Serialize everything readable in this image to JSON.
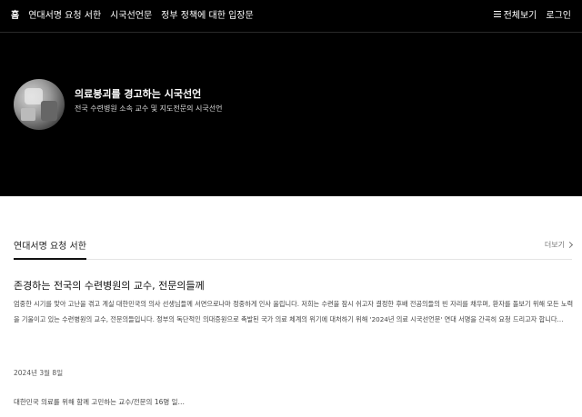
{
  "nav": {
    "items": [
      {
        "label": "홈",
        "active": true
      },
      {
        "label": "연대서명 요청 서한",
        "active": false
      },
      {
        "label": "시국선언문",
        "active": false
      },
      {
        "label": "정부 정책에 대한 입장문",
        "active": false
      }
    ],
    "view_all": "전체보기",
    "view_all_icon": "menu-icon",
    "login": "로그인"
  },
  "hero": {
    "title": "의료붕괴를 경고하는 시국선언",
    "subtitle": "전국 수련병원 소속 교수 및 지도전문의 시국선언"
  },
  "section": {
    "title": "연대서명 요청 서한",
    "more_label": "더보기",
    "more_icon": "chevron-right-icon"
  },
  "post": {
    "title": "존경하는 전국의 수련병원의 교수, 전문의들께",
    "body": "엄중한 시기를 맞아 고난을 겪고 계실 대한민국의 의사 선생님들께 서면으로나마 정중하게 인사 올립니다. 저희는 수련을 잠시 쉬고자 결정한 후배 전공의들의 빈 자리를 채우며, 환자를 돌보기 위해 모든 노력을 기울이고 있는 수련병원의 교수, 전문의들입니다. 정부의 독단적인 의대증원으로 촉발된 국가 의료 체계의 위기에 대처하기 위해 '2024년 의료 시국선언문' 연대 서명을 간곡히 요청 드리고자 합니다…",
    "date": "2024년 3월 8일",
    "footer": "대한민국 의료를 위해 함께 고민하는 교수/전문의 16명 일…"
  }
}
